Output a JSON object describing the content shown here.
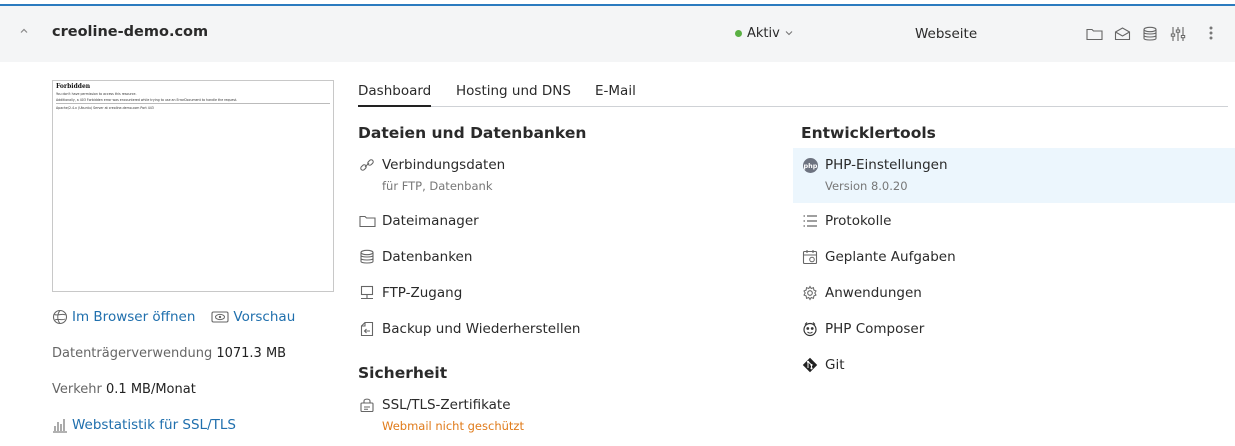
{
  "header": {
    "domain": "creoline-demo.com",
    "status": "Aktiv",
    "type": "Webseite",
    "status_color": "#5ab043",
    "icons": [
      "folder-icon",
      "mail-icon",
      "database-icon",
      "sliders-icon",
      "more-vertical-icon"
    ]
  },
  "preview": {
    "title": "Forbidden",
    "line1": "You don't have permission to access this resource.",
    "line2": "Additionally, a 403 Forbidden error was encountered while trying to use an ErrorDocument to handle the request.",
    "line3": "Apache/2.4.x (Ubuntu) Server at creoline-demo.com Port 443"
  },
  "left": {
    "open_browser": "Im Browser öffnen",
    "preview_link": "Vorschau",
    "disk_label": "Datenträgerverwendung",
    "disk_value": "1071.3 MB",
    "traffic_label": "Verkehr",
    "traffic_value": "0.1 MB/Monat",
    "webstats": "Webstatistik für SSL/TLS"
  },
  "tabs": [
    "Dashboard",
    "Hosting und DNS",
    "E-Mail"
  ],
  "sections": {
    "files": "Dateien und Datenbanken",
    "security": "Sicherheit",
    "dev": "Entwicklertools"
  },
  "files_items": [
    {
      "label": "Verbindungsdaten",
      "sub": "für FTP, Datenbank",
      "icon": "link-icon"
    },
    {
      "label": "Dateimanager",
      "icon": "folder-icon"
    },
    {
      "label": "Datenbanken",
      "icon": "database-icon"
    },
    {
      "label": "FTP-Zugang",
      "icon": "network-icon"
    },
    {
      "label": "Backup und Wiederherstellen",
      "icon": "backup-icon"
    }
  ],
  "security_items": [
    {
      "label": "SSL/TLS-Zertifikate",
      "sub": "Webmail nicht geschützt",
      "icon": "certificate-icon",
      "sub_color": "#e07b1a"
    }
  ],
  "dev_items": [
    {
      "label": "PHP-Einstellungen",
      "sub": "Version 8.0.20",
      "icon": "php-icon"
    },
    {
      "label": "Protokolle",
      "icon": "list-icon"
    },
    {
      "label": "Geplante Aufgaben",
      "icon": "calendar-icon"
    },
    {
      "label": "Anwendungen",
      "icon": "gear-icon"
    },
    {
      "label": "PHP Composer",
      "icon": "composer-icon"
    },
    {
      "label": "Git",
      "icon": "git-icon"
    }
  ],
  "colors": {
    "accent": "#2b7bbf",
    "link": "#1f6fad",
    "highlight": "#ecf6fd",
    "warning": "#e07b1a"
  }
}
